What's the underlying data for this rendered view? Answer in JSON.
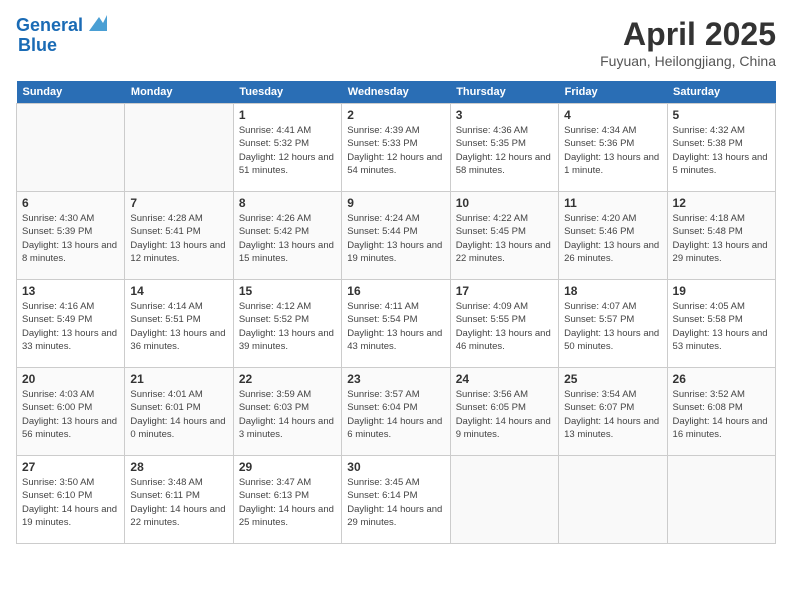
{
  "header": {
    "logo_line1": "General",
    "logo_line2": "Blue",
    "title": "April 2025",
    "subtitle": "Fuyuan, Heilongjiang, China"
  },
  "days_of_week": [
    "Sunday",
    "Monday",
    "Tuesday",
    "Wednesday",
    "Thursday",
    "Friday",
    "Saturday"
  ],
  "weeks": [
    [
      {
        "num": "",
        "info": ""
      },
      {
        "num": "",
        "info": ""
      },
      {
        "num": "1",
        "info": "Sunrise: 4:41 AM\nSunset: 5:32 PM\nDaylight: 12 hours and 51 minutes."
      },
      {
        "num": "2",
        "info": "Sunrise: 4:39 AM\nSunset: 5:33 PM\nDaylight: 12 hours and 54 minutes."
      },
      {
        "num": "3",
        "info": "Sunrise: 4:36 AM\nSunset: 5:35 PM\nDaylight: 12 hours and 58 minutes."
      },
      {
        "num": "4",
        "info": "Sunrise: 4:34 AM\nSunset: 5:36 PM\nDaylight: 13 hours and 1 minute."
      },
      {
        "num": "5",
        "info": "Sunrise: 4:32 AM\nSunset: 5:38 PM\nDaylight: 13 hours and 5 minutes."
      }
    ],
    [
      {
        "num": "6",
        "info": "Sunrise: 4:30 AM\nSunset: 5:39 PM\nDaylight: 13 hours and 8 minutes."
      },
      {
        "num": "7",
        "info": "Sunrise: 4:28 AM\nSunset: 5:41 PM\nDaylight: 13 hours and 12 minutes."
      },
      {
        "num": "8",
        "info": "Sunrise: 4:26 AM\nSunset: 5:42 PM\nDaylight: 13 hours and 15 minutes."
      },
      {
        "num": "9",
        "info": "Sunrise: 4:24 AM\nSunset: 5:44 PM\nDaylight: 13 hours and 19 minutes."
      },
      {
        "num": "10",
        "info": "Sunrise: 4:22 AM\nSunset: 5:45 PM\nDaylight: 13 hours and 22 minutes."
      },
      {
        "num": "11",
        "info": "Sunrise: 4:20 AM\nSunset: 5:46 PM\nDaylight: 13 hours and 26 minutes."
      },
      {
        "num": "12",
        "info": "Sunrise: 4:18 AM\nSunset: 5:48 PM\nDaylight: 13 hours and 29 minutes."
      }
    ],
    [
      {
        "num": "13",
        "info": "Sunrise: 4:16 AM\nSunset: 5:49 PM\nDaylight: 13 hours and 33 minutes."
      },
      {
        "num": "14",
        "info": "Sunrise: 4:14 AM\nSunset: 5:51 PM\nDaylight: 13 hours and 36 minutes."
      },
      {
        "num": "15",
        "info": "Sunrise: 4:12 AM\nSunset: 5:52 PM\nDaylight: 13 hours and 39 minutes."
      },
      {
        "num": "16",
        "info": "Sunrise: 4:11 AM\nSunset: 5:54 PM\nDaylight: 13 hours and 43 minutes."
      },
      {
        "num": "17",
        "info": "Sunrise: 4:09 AM\nSunset: 5:55 PM\nDaylight: 13 hours and 46 minutes."
      },
      {
        "num": "18",
        "info": "Sunrise: 4:07 AM\nSunset: 5:57 PM\nDaylight: 13 hours and 50 minutes."
      },
      {
        "num": "19",
        "info": "Sunrise: 4:05 AM\nSunset: 5:58 PM\nDaylight: 13 hours and 53 minutes."
      }
    ],
    [
      {
        "num": "20",
        "info": "Sunrise: 4:03 AM\nSunset: 6:00 PM\nDaylight: 13 hours and 56 minutes."
      },
      {
        "num": "21",
        "info": "Sunrise: 4:01 AM\nSunset: 6:01 PM\nDaylight: 14 hours and 0 minutes."
      },
      {
        "num": "22",
        "info": "Sunrise: 3:59 AM\nSunset: 6:03 PM\nDaylight: 14 hours and 3 minutes."
      },
      {
        "num": "23",
        "info": "Sunrise: 3:57 AM\nSunset: 6:04 PM\nDaylight: 14 hours and 6 minutes."
      },
      {
        "num": "24",
        "info": "Sunrise: 3:56 AM\nSunset: 6:05 PM\nDaylight: 14 hours and 9 minutes."
      },
      {
        "num": "25",
        "info": "Sunrise: 3:54 AM\nSunset: 6:07 PM\nDaylight: 14 hours and 13 minutes."
      },
      {
        "num": "26",
        "info": "Sunrise: 3:52 AM\nSunset: 6:08 PM\nDaylight: 14 hours and 16 minutes."
      }
    ],
    [
      {
        "num": "27",
        "info": "Sunrise: 3:50 AM\nSunset: 6:10 PM\nDaylight: 14 hours and 19 minutes."
      },
      {
        "num": "28",
        "info": "Sunrise: 3:48 AM\nSunset: 6:11 PM\nDaylight: 14 hours and 22 minutes."
      },
      {
        "num": "29",
        "info": "Sunrise: 3:47 AM\nSunset: 6:13 PM\nDaylight: 14 hours and 25 minutes."
      },
      {
        "num": "30",
        "info": "Sunrise: 3:45 AM\nSunset: 6:14 PM\nDaylight: 14 hours and 29 minutes."
      },
      {
        "num": "",
        "info": ""
      },
      {
        "num": "",
        "info": ""
      },
      {
        "num": "",
        "info": ""
      }
    ]
  ]
}
